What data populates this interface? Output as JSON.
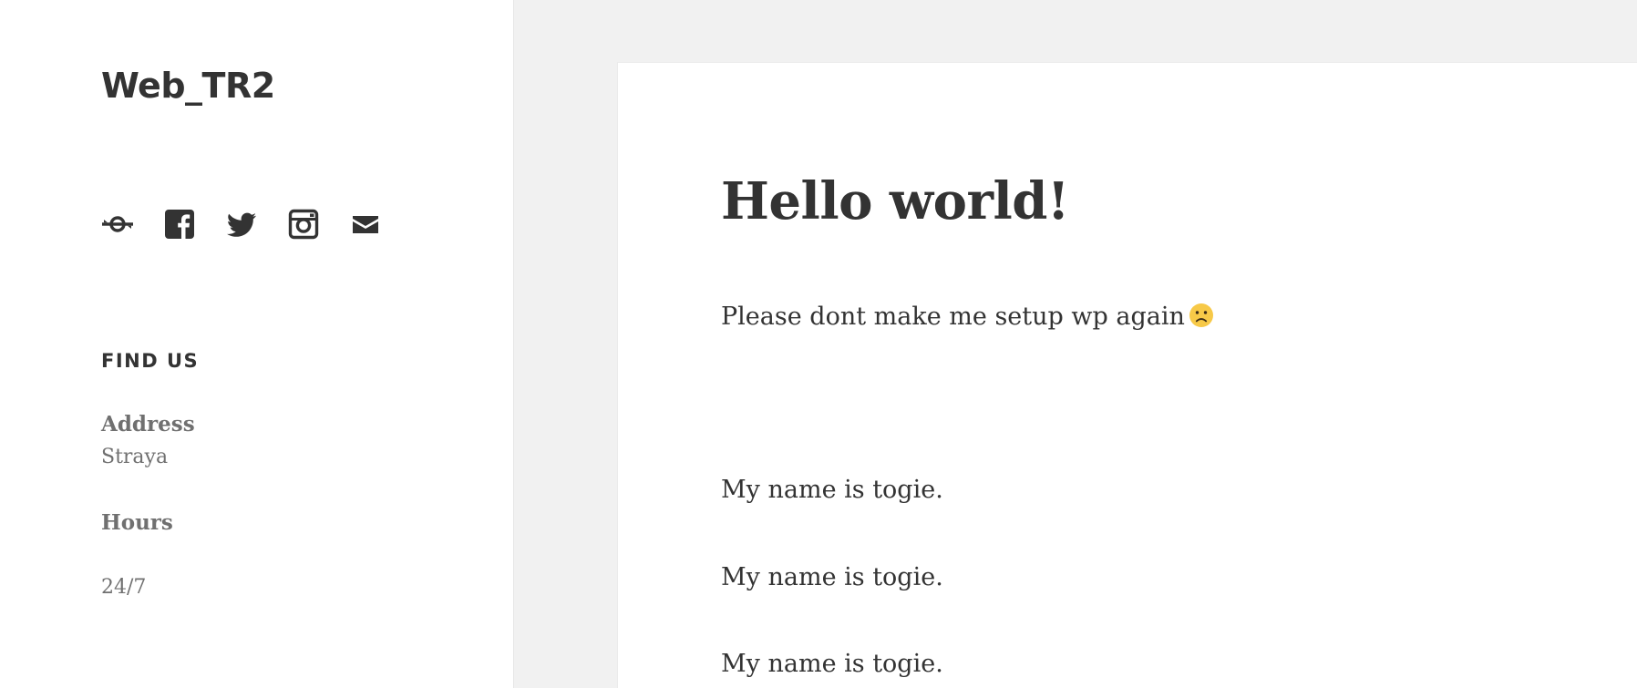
{
  "site": {
    "title": "Web_TR2"
  },
  "social_links": [
    {
      "icon": "wordpress-icon"
    },
    {
      "icon": "facebook-icon"
    },
    {
      "icon": "twitter-icon"
    },
    {
      "icon": "instagram-icon"
    },
    {
      "icon": "mail-icon"
    }
  ],
  "widget": {
    "title": "FIND US",
    "address_label": "Address",
    "address_value": "Straya",
    "hours_label": "Hours",
    "hours_value": "24/7"
  },
  "post": {
    "title": "Hello world!",
    "paragraphs": [
      "Please dont make me setup wp again",
      "My name is togie.",
      "My name is togie.",
      "My name is togie."
    ],
    "emoji": "slightly-frowning-face-icon"
  },
  "colors": {
    "text": "#333333",
    "muted": "#707070",
    "background": "#f1f1f1",
    "panel": "#ffffff",
    "emoji": "#f7c948"
  }
}
